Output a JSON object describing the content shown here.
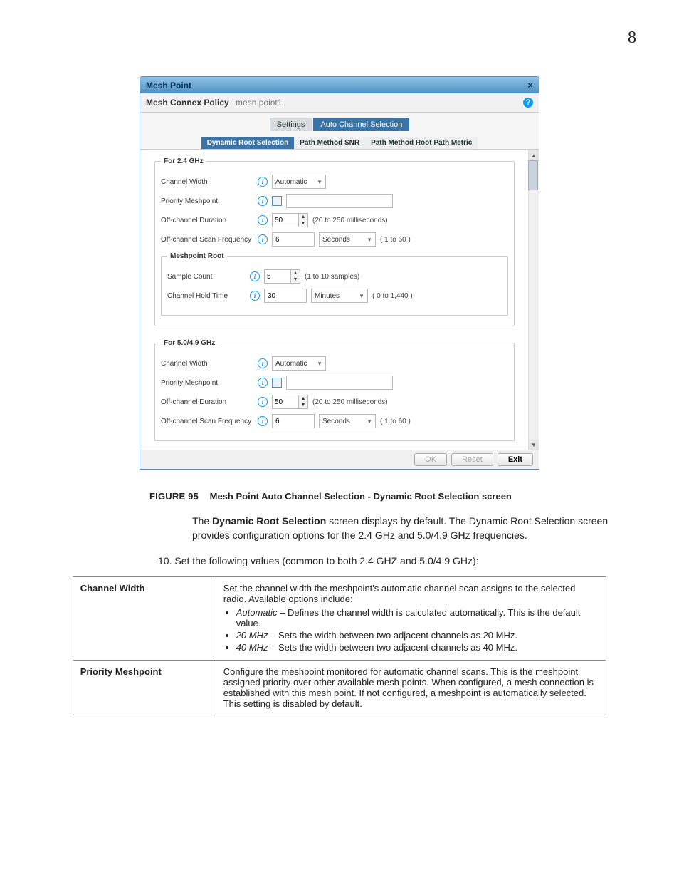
{
  "page_number": "8",
  "dialog": {
    "title": "Mesh Point",
    "subtitle_label": "Mesh Connex Policy",
    "subtitle_name": "mesh point1",
    "main_tabs": {
      "settings": "Settings",
      "auto_channel": "Auto Channel Selection"
    },
    "sub_tabs": {
      "dynamic_root": "Dynamic Root Selection",
      "path_snr": "Path Method SNR",
      "path_root": "Path Method Root Path Metric"
    },
    "legend_24": "For 2.4 GHz",
    "legend_50": "For 5.0/4.9 GHz",
    "legend_root": "Meshpoint Root",
    "labels": {
      "channel_width": "Channel Width",
      "priority_meshpoint": "Priority Meshpoint",
      "off_channel_duration": "Off-channel Duration",
      "off_channel_scan_freq": "Off-channel Scan Frequency",
      "sample_count": "Sample Count",
      "channel_hold_time": "Channel Hold Time"
    },
    "values": {
      "channel_width_sel": "Automatic",
      "off_channel_duration_24": "50",
      "off_channel_duration_hint": "(20 to 250 milliseconds)",
      "off_channel_scan_24": "6",
      "seconds": "Seconds",
      "scan_hint": "( 1 to 60 )",
      "sample_count": "5",
      "sample_hint": "(1 to 10 samples)",
      "hold_time": "30",
      "minutes": "Minutes",
      "hold_hint": "( 0 to 1,440 )",
      "off_channel_duration_50": "50",
      "off_channel_scan_50": "6"
    },
    "buttons": {
      "ok": "OK",
      "reset": "Reset",
      "exit": "Exit"
    }
  },
  "caption": {
    "figure": "FIGURE 95",
    "title": "Mesh Point Auto Channel Selection - Dynamic Root Selection screen"
  },
  "para1_a": "The ",
  "para1_bold": "Dynamic Root Selection",
  "para1_b": " screen displays by default. The Dynamic Root Selection screen provides configuration options for the 2.4 GHz and 5.0/4.9 GHz frequencies.",
  "step10": "10. Set the following values (common to both 2.4 GHZ and 5.0/4.9 GHz):",
  "table": {
    "r1_label": "Channel Width",
    "r1_intro": "Set the channel width the meshpoint's automatic channel scan assigns to the selected radio. Available options include:",
    "r1_opt1_i": "Automatic",
    "r1_opt1_t": " – Defines the channel width is calculated automatically. This is the default value.",
    "r1_opt2_i": "20 MHz",
    "r1_opt2_t": " – Sets the width between two adjacent channels as 20 MHz.",
    "r1_opt3_i": "40 MHz",
    "r1_opt3_t": " – Sets the width between two adjacent channels as 40 MHz.",
    "r2_label": "Priority Meshpoint",
    "r2_text": "Configure the meshpoint monitored for automatic channel scans. This is the meshpoint assigned priority over other available mesh points. When configured, a mesh connection is established with this mesh point. If not configured, a meshpoint is automatically selected. This setting is disabled by default."
  }
}
